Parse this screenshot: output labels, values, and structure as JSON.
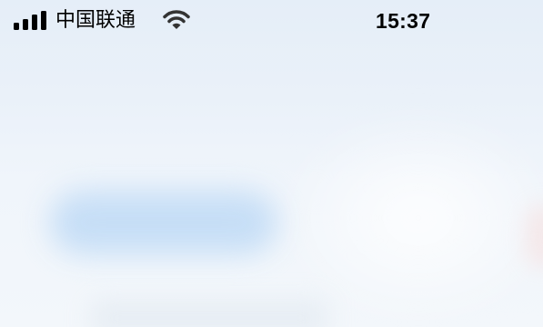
{
  "status_bar": {
    "carrier": "中国联通",
    "time": "15:37",
    "signal_bars": 4,
    "signal_icon": "cellular-signal-icon",
    "wifi_icon": "wifi-icon"
  },
  "colors": {
    "status_text": "#000000",
    "wifi_icon": "#333333",
    "background_top": "#e5eef8",
    "background_bottom": "#f3f7fb",
    "blurred_accent": "#c2dcf6"
  }
}
